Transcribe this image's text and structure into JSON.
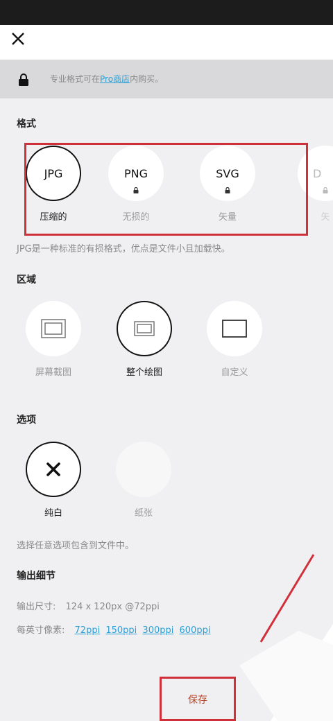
{
  "banner": {
    "text_before": "专业格式可在",
    "link_text": "Pro商店",
    "text_after": "内购买。"
  },
  "format": {
    "title": "格式",
    "options": [
      {
        "name": "JPG",
        "label": "压缩的",
        "selected": true,
        "locked": false
      },
      {
        "name": "PNG",
        "label": "无损的",
        "selected": false,
        "locked": true
      },
      {
        "name": "SVG",
        "label": "矢量",
        "selected": false,
        "locked": true
      },
      {
        "name": "D",
        "label": "矢",
        "selected": false,
        "locked": true
      }
    ],
    "description": "JPG是一种标准的有损格式，优点是文件小且加载快。"
  },
  "area": {
    "title": "区域",
    "options": [
      {
        "label": "屏幕截图",
        "icon": "screenshot-frame-icon",
        "selected": false
      },
      {
        "label": "整个绘图",
        "icon": "whole-drawing-frame-icon",
        "selected": true
      },
      {
        "label": "自定义",
        "icon": "custom-frame-icon",
        "selected": false
      }
    ]
  },
  "options": {
    "title": "选项",
    "items": [
      {
        "label": "纯白",
        "icon": "x-icon",
        "selected": true
      },
      {
        "label": "纸张",
        "icon": "paper-swatch",
        "selected": false
      }
    ],
    "description": "选择任意选项包含到文件中。"
  },
  "output": {
    "title": "输出细节",
    "size_label": "输出尺寸:",
    "size_value": "124 x 120px @72ppi",
    "ppi_label": "每英寸像素:",
    "ppi_options": [
      "72ppi",
      "150ppi",
      "300ppi",
      "600ppi"
    ]
  },
  "save_label": "保存",
  "colors": {
    "accent_link": "#2a9fd6",
    "highlight": "#d0303a",
    "save_text": "#b3472e"
  }
}
